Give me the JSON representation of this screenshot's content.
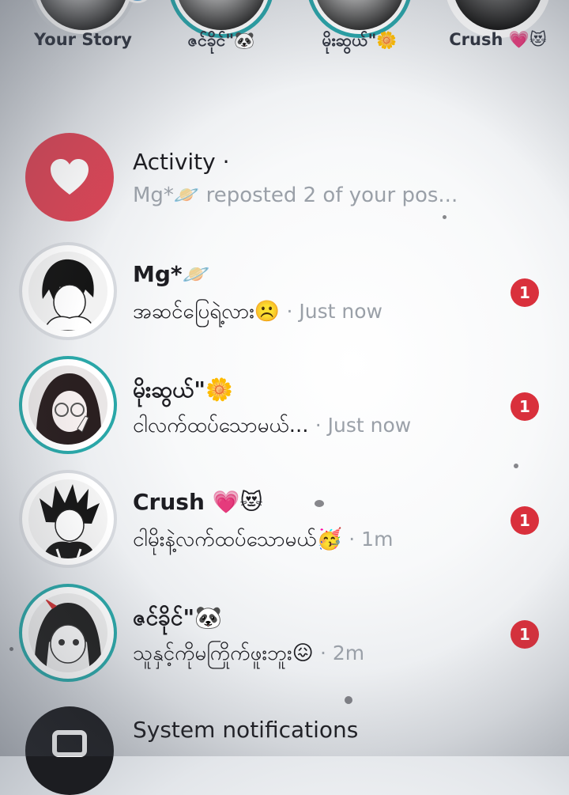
{
  "stories": [
    {
      "label": "Your Story",
      "has_add": true
    },
    {
      "label": "ဇင်ခိုင်\"🐼"
    },
    {
      "label": "မိုးဆွယ်\"🌼"
    },
    {
      "label": "Crush 💗😻"
    }
  ],
  "activity": {
    "title": "Activity ·",
    "subtitle": "Mg*🪐 reposted 2 of your pos..."
  },
  "chats": [
    {
      "name": "Mg*🪐",
      "message": "အဆင်ပြေရဲ့လား☹️",
      "time": "· Just now",
      "unread": "1"
    },
    {
      "name": "မိုးဆွယ်\"🌼",
      "message": "ငါလက်ထပ်သောမယ်...",
      "time": "· Just now",
      "unread": "1"
    },
    {
      "name": "Crush 💗😻",
      "message": "ငါမိုးနဲ့လက်ထပ်သောမယ်🥳",
      "time": "· 1m",
      "unread": "1"
    },
    {
      "name": "ဇင်ခိုင်\"🐼",
      "message": "သူနှင့်ကိုမကြိုက်ဖူးဘူး😖",
      "time": "· 2m",
      "unread": "1"
    }
  ],
  "system": {
    "title": "System notifications"
  },
  "colors": {
    "accent_teal": "#2aa7a8",
    "badge_red": "#d9303c",
    "activity_red": "#d94556"
  },
  "icons": {
    "activity": "heart-icon",
    "system": "inbox-icon",
    "add": "plus-icon"
  }
}
